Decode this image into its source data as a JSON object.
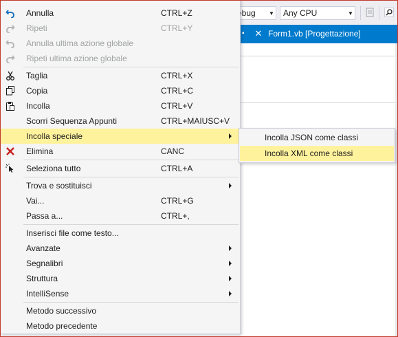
{
  "toolbar": {
    "config_combo": "ebug",
    "platform_combo": "Any CPU",
    "dropdown_arrow": "▼"
  },
  "editor": {
    "active_tab_label": "Form1.vb [Progettazione]",
    "pin_glyph": "▪",
    "close_glyph": "✕"
  },
  "menu": {
    "items": [
      {
        "label": "Annulla",
        "shortcut": "CTRL+Z",
        "icon": "undo-icon"
      },
      {
        "label": "Ripeti",
        "shortcut": "CTRL+Y",
        "icon": "redo-icon"
      },
      {
        "label": "Annulla ultima azione globale",
        "icon": "global-undo-icon"
      },
      {
        "label": "Ripeti ultima azione globale",
        "icon": "global-redo-icon"
      },
      {
        "label": "Taglia",
        "shortcut": "CTRL+X",
        "icon": "cut-icon"
      },
      {
        "label": "Copia",
        "shortcut": "CTRL+C",
        "icon": "copy-icon"
      },
      {
        "label": "Incolla",
        "shortcut": "CTRL+V",
        "icon": "paste-icon"
      },
      {
        "label": "Scorri Sequenza Appunti",
        "shortcut": "CTRL+MAIUSC+V"
      },
      {
        "label": "Incolla speciale"
      },
      {
        "label": "Elimina",
        "shortcut": "CANC",
        "icon": "delete-icon"
      },
      {
        "label": "Seleziona tutto",
        "shortcut": "CTRL+A",
        "icon": "select-all-icon"
      },
      {
        "label": "Trova e sostituisci"
      },
      {
        "label": "Vai...",
        "shortcut": "CTRL+G"
      },
      {
        "label": "Passa a...",
        "shortcut": "CTRL+,"
      },
      {
        "label": "Inserisci file come testo..."
      },
      {
        "label": "Avanzate"
      },
      {
        "label": "Segnalibri"
      },
      {
        "label": "Struttura"
      },
      {
        "label": "IntelliSense"
      },
      {
        "label": "Metodo successivo"
      },
      {
        "label": "Metodo precedente"
      }
    ]
  },
  "submenu": {
    "items": [
      {
        "label": "Incolla JSON come classi"
      },
      {
        "label": "Incolla XML come classi"
      }
    ]
  },
  "colors": {
    "highlight": "#fff29d",
    "accent": "#007acc",
    "menu_bg": "#f5f5f5",
    "disabled_text": "#a2a4a5",
    "delete_red": "#c5221f"
  }
}
